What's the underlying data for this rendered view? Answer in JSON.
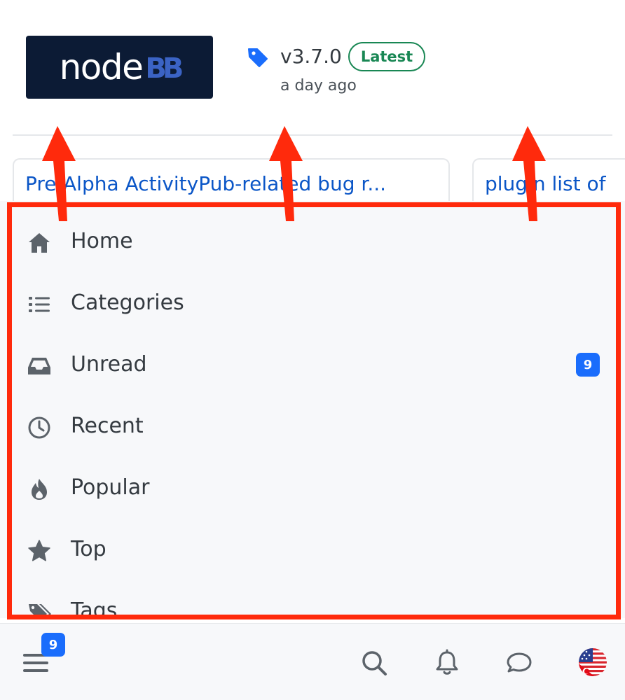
{
  "header": {
    "logo_word": "node",
    "logo_mark": "BB",
    "version": "v3.7.0",
    "latest_badge": "Latest",
    "release_time": "a day ago",
    "tag_icon": "tag-icon"
  },
  "topics": [
    {
      "title": "Pre-Alpha ActivityPub-related bug r..."
    },
    {
      "title": "plugin list of"
    }
  ],
  "nav": {
    "items": [
      {
        "label": "Home",
        "icon": "home-icon"
      },
      {
        "label": "Categories",
        "icon": "list-icon"
      },
      {
        "label": "Unread",
        "icon": "inbox-icon",
        "badge": "9"
      },
      {
        "label": "Recent",
        "icon": "clock-icon"
      },
      {
        "label": "Popular",
        "icon": "fire-icon"
      },
      {
        "label": "Top",
        "icon": "star-icon"
      },
      {
        "label": "Tags",
        "icon": "tags-icon"
      }
    ]
  },
  "bottom_bar": {
    "menu_badge": "9",
    "icons": [
      "menu-icon",
      "search-icon",
      "bell-icon",
      "chat-icon",
      "avatar"
    ]
  },
  "colors": {
    "accent": "#1a6dfc",
    "success": "#198754",
    "link": "#0b56c7",
    "annotation": "#ff2a0c",
    "logo_bg": "#0c1b35"
  }
}
